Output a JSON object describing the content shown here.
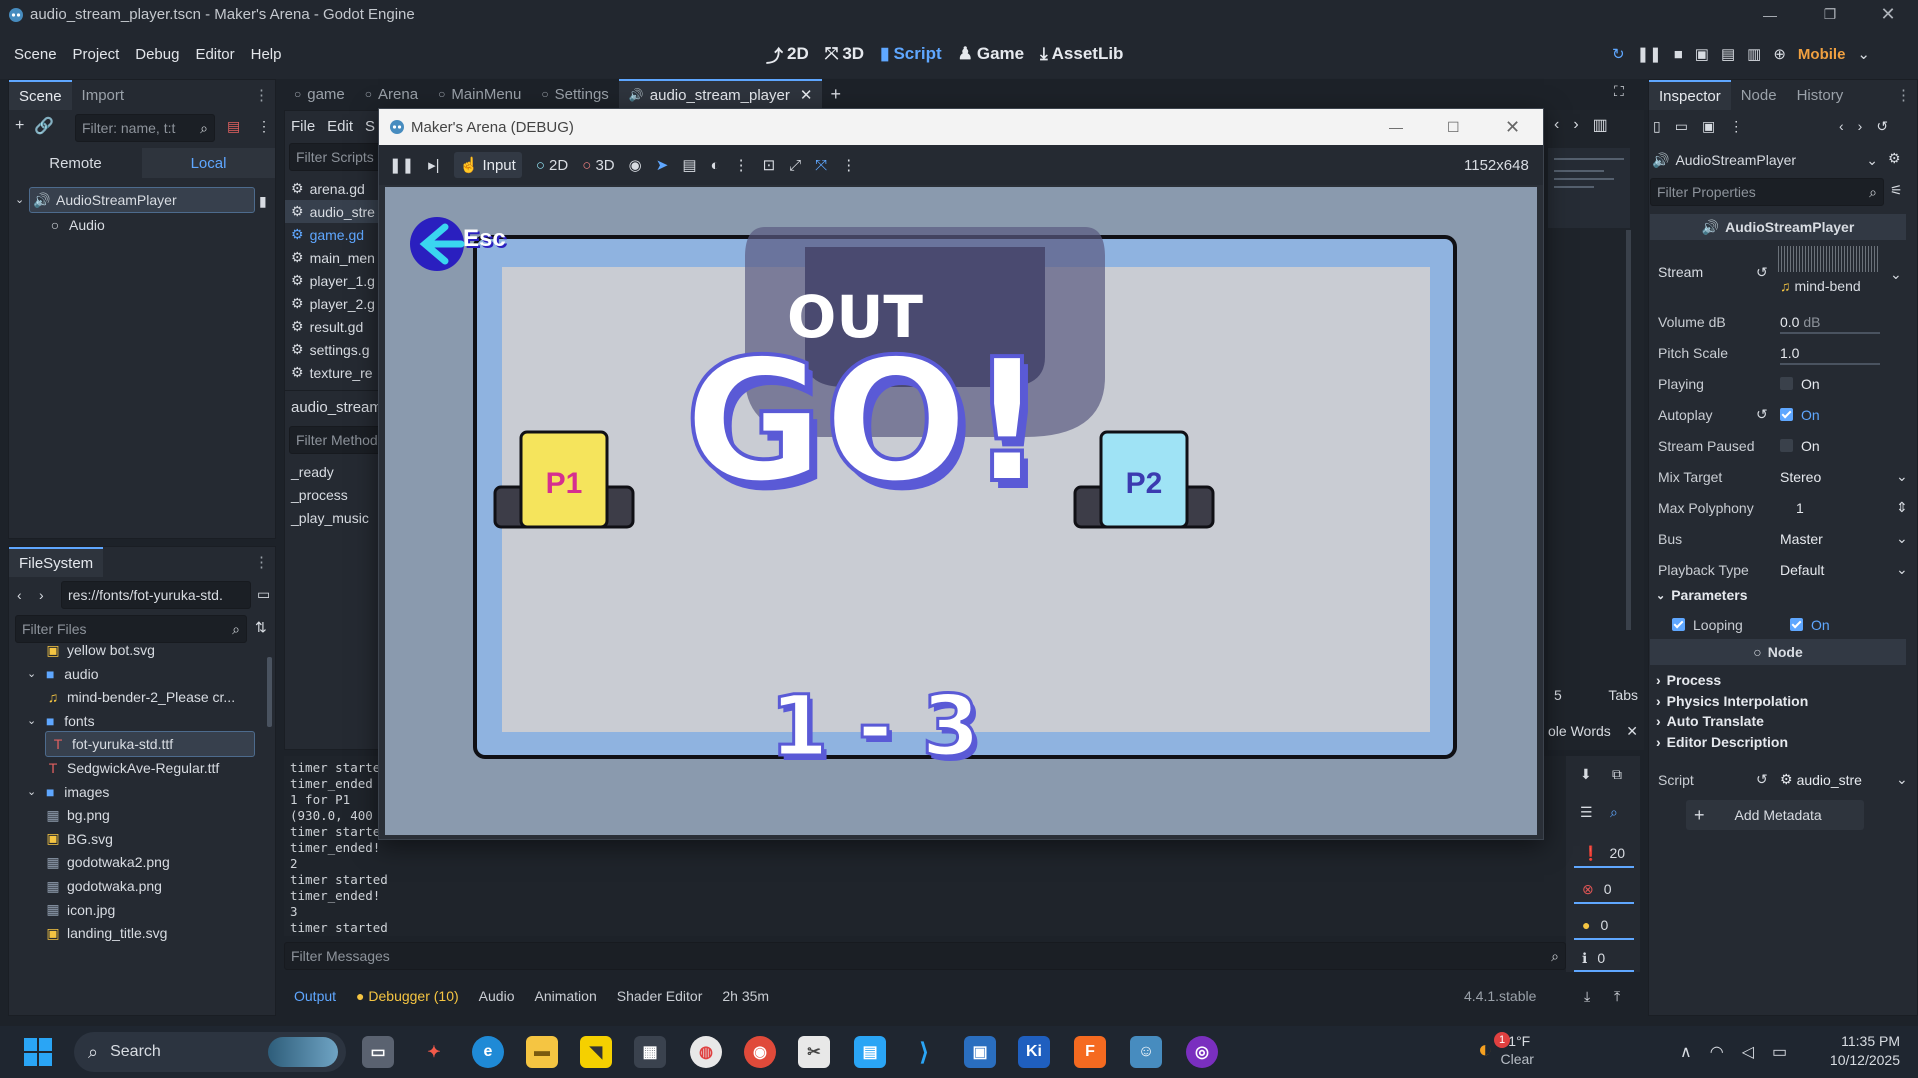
{
  "window": {
    "title": "audio_stream_player.tscn - Maker's Arena - Godot Engine"
  },
  "menu": [
    "Scene",
    "Project",
    "Debug",
    "Editor",
    "Help"
  ],
  "modes": {
    "m2d": "2D",
    "m3d": "3D",
    "script": "Script",
    "game": "Game",
    "assetlib": "AssetLib"
  },
  "renderer": "Mobile",
  "scene_dock": {
    "tabs": [
      "Scene",
      "Import"
    ],
    "filter_placeholder": "Filter: name, t:t",
    "remote": "Remote",
    "local": "Local",
    "nodes": [
      "AudioStreamPlayer",
      "Audio"
    ]
  },
  "filesystem": {
    "tab": "FileSystem",
    "path": "res://fonts/fot-yuruka-std.",
    "filter_placeholder": "Filter Files",
    "items": [
      {
        "label": "yellow bot.svg",
        "kind": "svg"
      },
      {
        "label": "audio",
        "kind": "folder"
      },
      {
        "label": "mind-bender-2_Please cr...",
        "kind": "audio"
      },
      {
        "label": "fonts",
        "kind": "folder"
      },
      {
        "label": "fot-yuruka-std.ttf",
        "kind": "font"
      },
      {
        "label": "SedgwickAve-Regular.ttf",
        "kind": "font"
      },
      {
        "label": "images",
        "kind": "folder"
      },
      {
        "label": "bg.png",
        "kind": "image"
      },
      {
        "label": "BG.svg",
        "kind": "svg"
      },
      {
        "label": "godotwaka2.png",
        "kind": "image"
      },
      {
        "label": "godotwaka.png",
        "kind": "image"
      },
      {
        "label": "icon.jpg",
        "kind": "image"
      },
      {
        "label": "landing_title.svg",
        "kind": "svg"
      }
    ]
  },
  "scene_tabs": [
    "game",
    "Arena",
    "MainMenu",
    "Settings",
    "audio_stream_player"
  ],
  "script_panel": {
    "menu": [
      "File",
      "Edit",
      "S"
    ],
    "filter_scripts": "Filter Scripts",
    "scripts": [
      "arena.gd",
      "audio_stre",
      "game.gd",
      "main_men",
      "player_1.g",
      "player_2.g",
      "result.gd",
      "settings.g",
      "texture_re"
    ],
    "current": "audio_stream",
    "filter_methods": "Filter Method",
    "methods": [
      "_ready",
      "_process",
      "_play_music"
    ],
    "tabs_count": "5",
    "tabs_label": "Tabs",
    "whole_words": "ole Words"
  },
  "game_window": {
    "title": "Maker's Arena (DEBUG)",
    "toolbar": {
      "input": "Input",
      "m2d": "2D",
      "m3d": "3D",
      "resolution": "1152x648"
    },
    "game": {
      "esc": "Esc",
      "out": "OUT",
      "go": "GO!",
      "p1": "P1",
      "p2": "P2",
      "score": "1 - 3"
    }
  },
  "console": {
    "lines": [
      "timer starte",
      "timer_ended",
      "1 for P1",
      "(930.0, 400",
      "timer starte",
      "timer_ended!",
      "2",
      "timer started",
      "timer_ended!",
      "3",
      "timer started"
    ],
    "filter_placeholder": "Filter Messages",
    "counts": {
      "messages": "20",
      "errors": "0",
      "warnings": "0",
      "info": "0"
    }
  },
  "bottom_tabs": [
    "Output",
    "Debugger (10)",
    "Audio",
    "Animation",
    "Shader Editor",
    "2h 35m"
  ],
  "version": "4.4.1.stable",
  "inspector": {
    "tabs": [
      "Inspector",
      "Node",
      "History"
    ],
    "node_type": "AudioStreamPlayer",
    "filter_placeholder": "Filter Properties",
    "class_header": "AudioStreamPlayer",
    "stream_label": "Stream",
    "stream_value": "mind-bend",
    "props": [
      {
        "label": "Volume dB",
        "value": "0.0",
        "unit": "dB"
      },
      {
        "label": "Pitch Scale",
        "value": "1.0"
      }
    ],
    "playing": {
      "label": "Playing",
      "value": "On"
    },
    "autoplay": {
      "label": "Autoplay",
      "value": "On"
    },
    "stream_paused": {
      "label": "Stream Paused",
      "value": "On"
    },
    "mix_target": {
      "label": "Mix Target",
      "value": "Stereo"
    },
    "max_polyphony": {
      "label": "Max Polyphony",
      "value": "1"
    },
    "bus": {
      "label": "Bus",
      "value": "Master"
    },
    "playback_type": {
      "label": "Playback Type",
      "value": "Default"
    },
    "parameters": "Parameters",
    "looping": {
      "label": "Looping",
      "value": "On"
    },
    "node_header": "Node",
    "sections": [
      "Process",
      "Physics Interpolation",
      "Auto Translate",
      "Editor Description"
    ],
    "script": {
      "label": "Script",
      "value": "audio_stre"
    },
    "add_metadata": "Add Metadata"
  },
  "taskbar": {
    "search": "Search",
    "weather_temp": "61°F",
    "weather_cond": "Clear",
    "time": "11:35 PM",
    "date": "10/12/2025",
    "badge": "1"
  },
  "colors": {
    "accent": "#5fa7ff",
    "panel": "#252a32",
    "bg": "#1d2229",
    "game_bg": "#8fb3e0",
    "p1": "#f5e45c",
    "p2": "#9fe3f5",
    "go_outline": "#5a5ad6"
  }
}
